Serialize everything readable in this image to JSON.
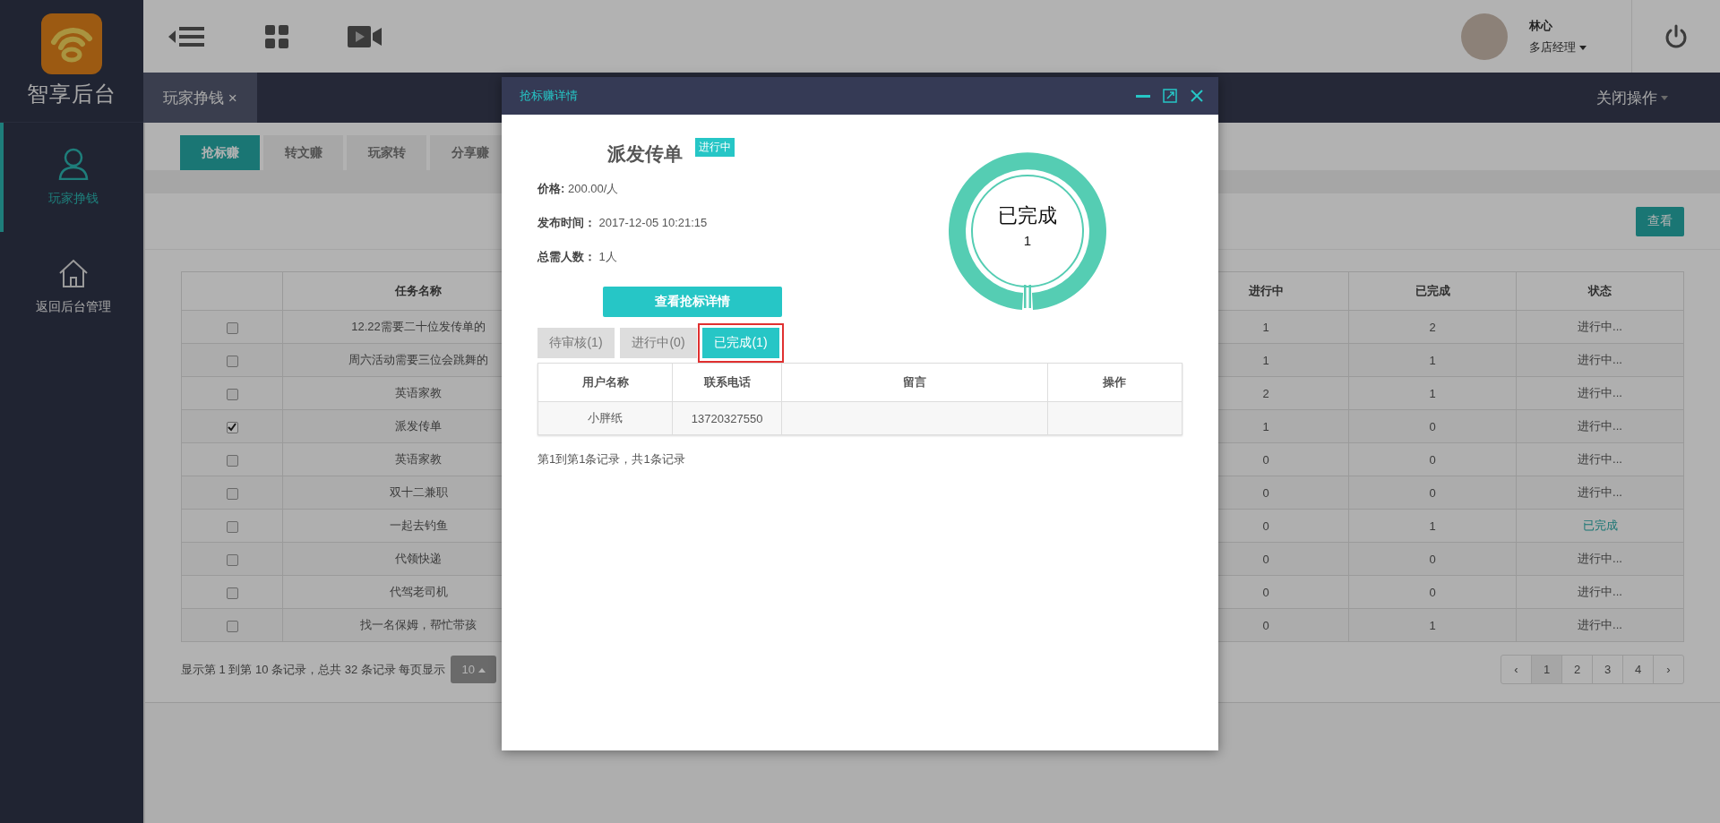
{
  "brand": {
    "name": "智享后台"
  },
  "sidebar": {
    "items": [
      {
        "label": "玩家挣钱",
        "kind": "user",
        "selected": true
      },
      {
        "label": "返回后台管理",
        "kind": "home",
        "selected": false
      }
    ]
  },
  "header": {
    "user": {
      "name": "林心",
      "role": "多店经理"
    }
  },
  "page_tabs": [
    {
      "label": "玩家挣钱 ×",
      "selected": true
    }
  ],
  "close_menu": {
    "label": "关闭操作"
  },
  "sub_tabs": [
    {
      "label": "抢标赚",
      "selected": true
    },
    {
      "label": "转文赚",
      "selected": false
    },
    {
      "label": "玩家转",
      "selected": false
    },
    {
      "label": "分享赚",
      "selected": false
    }
  ],
  "view_button": {
    "label": "查看"
  },
  "table": {
    "columns": [
      "任务名称",
      "进行中",
      "已完成",
      "状态"
    ],
    "rows": [
      {
        "checked": false,
        "name": "12.22需要二十位发传单的",
        "in_progress": "1",
        "done": "2",
        "status": "进行中...",
        "kind": "running"
      },
      {
        "checked": false,
        "name": "周六活动需要三位会跳舞的",
        "in_progress": "1",
        "done": "1",
        "status": "进行中...",
        "kind": "running"
      },
      {
        "checked": false,
        "name": "英语家教",
        "in_progress": "2",
        "done": "1",
        "status": "进行中...",
        "kind": "running"
      },
      {
        "checked": true,
        "name": "派发传单",
        "in_progress": "1",
        "done": "0",
        "status": "进行中...",
        "kind": "running"
      },
      {
        "checked": false,
        "name": "英语家教",
        "in_progress": "0",
        "done": "0",
        "status": "进行中...",
        "kind": "running"
      },
      {
        "checked": false,
        "name": "双十二兼职",
        "in_progress": "0",
        "done": "0",
        "status": "进行中...",
        "kind": "running"
      },
      {
        "checked": false,
        "name": "一起去钓鱼",
        "in_progress": "0",
        "done": "1",
        "status": "已完成",
        "kind": "finished"
      },
      {
        "checked": false,
        "name": "代领快递",
        "in_progress": "0",
        "done": "0",
        "status": "进行中...",
        "kind": "running"
      },
      {
        "checked": false,
        "name": "代驾老司机",
        "in_progress": "0",
        "done": "0",
        "status": "进行中...",
        "kind": "running"
      },
      {
        "checked": false,
        "name": "找一名保姆，帮忙带孩",
        "in_progress": "0",
        "done": "1",
        "status": "进行中...",
        "kind": "running"
      }
    ]
  },
  "table_footer": {
    "summary": "显示第 1 到第 10 条记录，总共 32 条记录 每页显示",
    "page_size": "10"
  },
  "pagination": {
    "prev": "‹",
    "next": "›",
    "pages": [
      {
        "label": "1",
        "selected": true
      },
      {
        "label": "2",
        "selected": false
      },
      {
        "label": "3",
        "selected": false
      },
      {
        "label": "4",
        "selected": false
      }
    ]
  },
  "modal": {
    "title": "抢标赚详情",
    "task_title": "派发传单",
    "badge": "进行中",
    "info": [
      {
        "label": "价格:",
        "value": "200.00/人"
      },
      {
        "label": "发布时间：",
        "value": "2017-12-05 10:21:15"
      },
      {
        "label": "总需人数：",
        "value": "1人"
      }
    ],
    "detail_button": "查看抢标详情",
    "ring": {
      "label": "已完成",
      "count": "1"
    },
    "tabs": [
      {
        "label": "待审核(1)",
        "selected": false,
        "highlighted": false
      },
      {
        "label": "进行中(0)",
        "selected": false,
        "highlighted": false
      },
      {
        "label": "已完成(1)",
        "selected": true,
        "highlighted": true
      }
    ],
    "table": {
      "columns": [
        "用户名称",
        "联系电话",
        "留言",
        "操作"
      ],
      "rows": [
        {
          "user": "小胖纸",
          "phone": "13720327550"
        }
      ]
    },
    "footer": "第1到第1条记录，共1条记录"
  }
}
